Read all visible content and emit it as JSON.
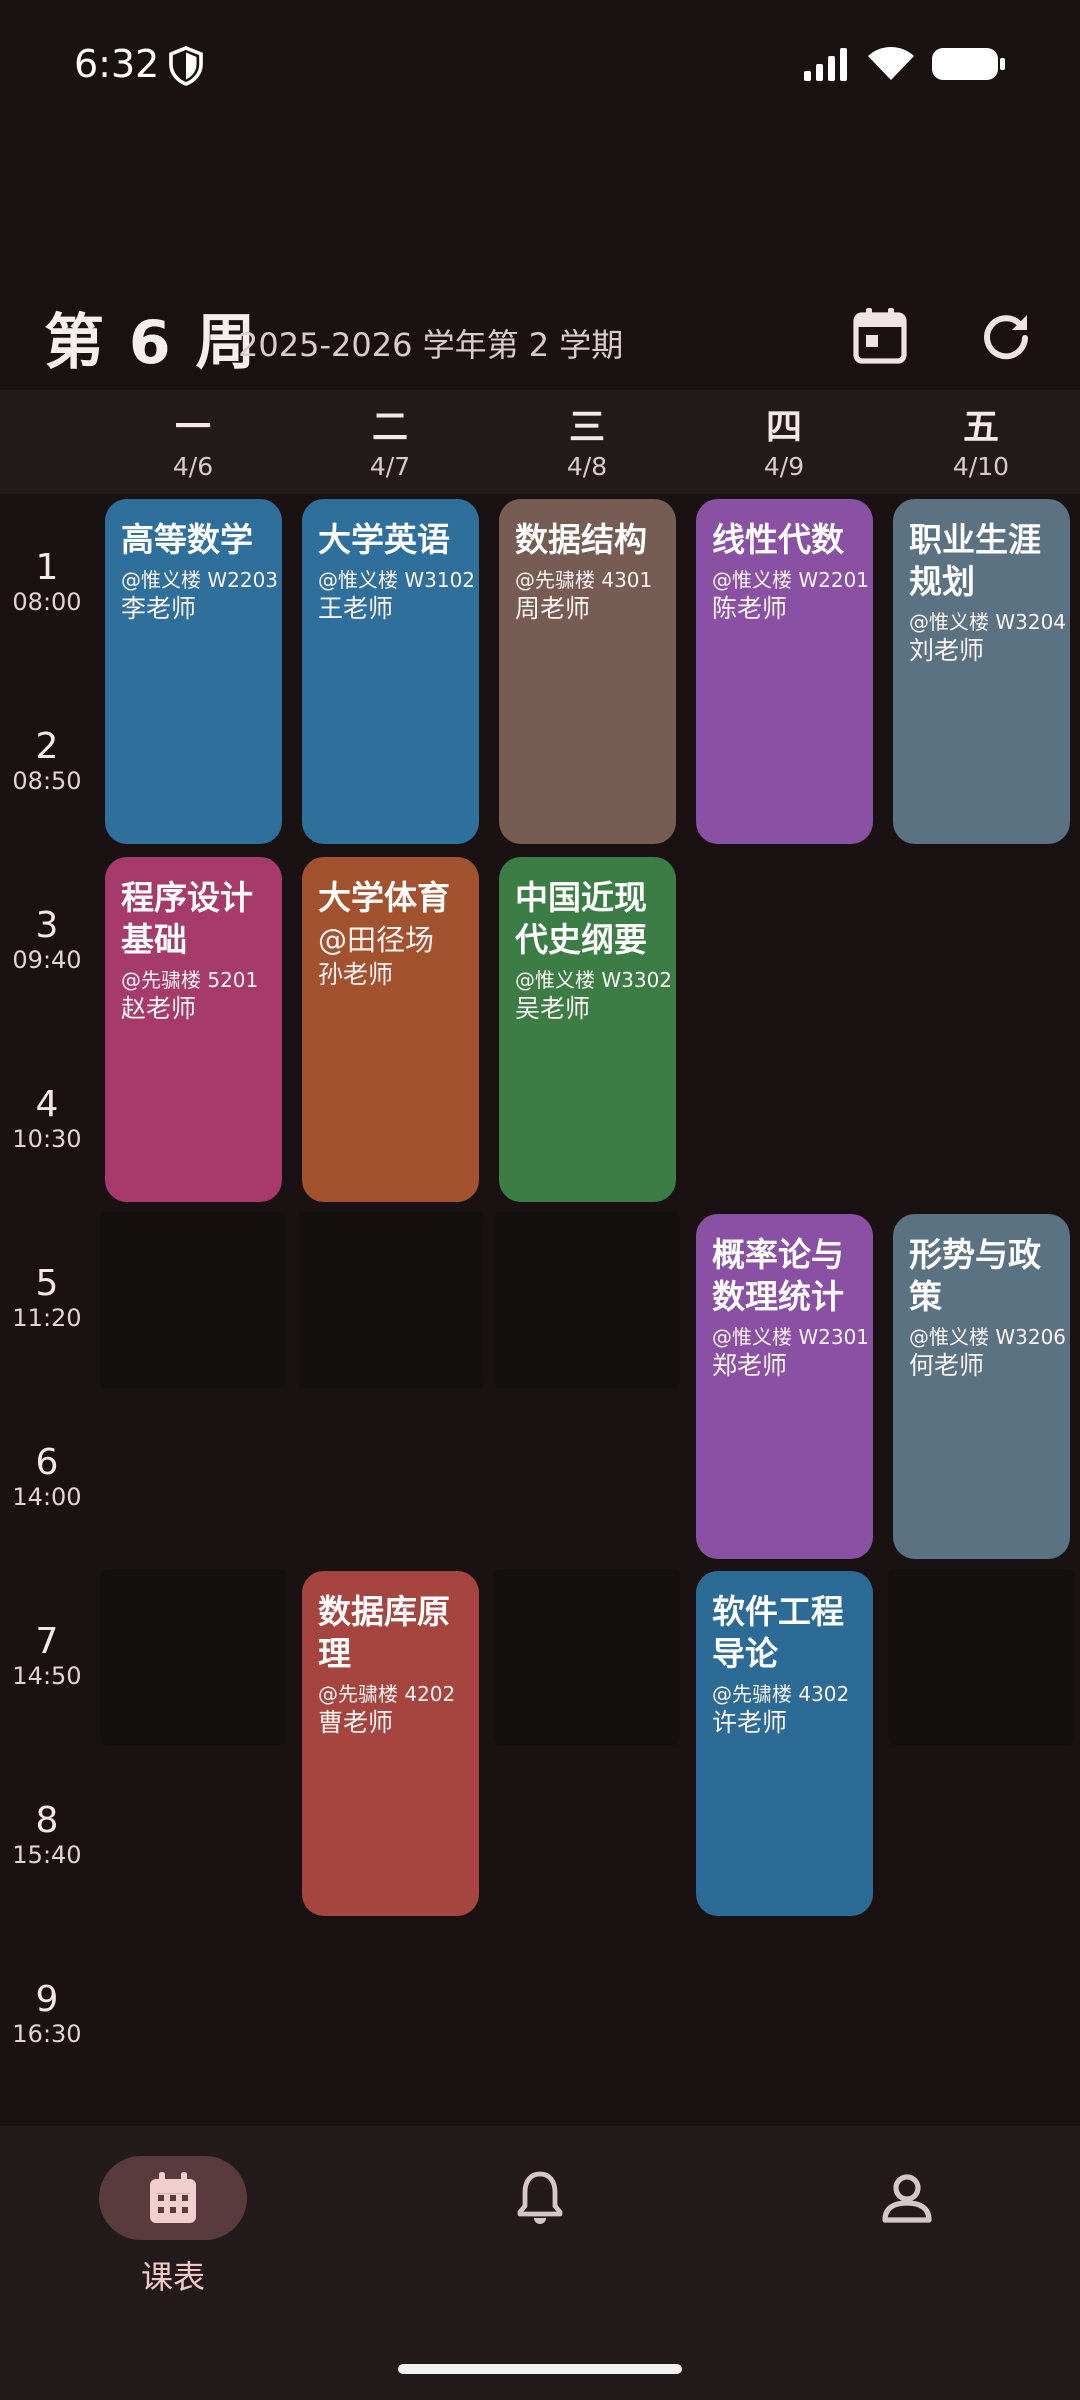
{
  "status_bar": {
    "time": "6:32"
  },
  "header": {
    "week": "第 6 周",
    "term": "2025-2026 学年第 2 学期"
  },
  "days": [
    {
      "name": "一",
      "date": "4/6"
    },
    {
      "name": "二",
      "date": "4/7"
    },
    {
      "name": "三",
      "date": "4/8"
    },
    {
      "name": "四",
      "date": "4/9"
    },
    {
      "name": "五",
      "date": "4/10"
    }
  ],
  "slots": [
    {
      "num": "1",
      "time": "08:00"
    },
    {
      "num": "2",
      "time": "08:50"
    },
    {
      "num": "3",
      "time": "09:40"
    },
    {
      "num": "4",
      "time": "10:30"
    },
    {
      "num": "5",
      "time": "11:20"
    },
    {
      "num": "6",
      "time": "14:00"
    },
    {
      "num": "7",
      "time": "14:50"
    },
    {
      "num": "8",
      "time": "15:40"
    },
    {
      "num": "9",
      "time": "16:30"
    }
  ],
  "courses": [
    {
      "name": "高等数学",
      "room": "@惟义楼 W2203",
      "teacher": "李老师",
      "color": "#2f6f9c"
    },
    {
      "name": "大学英语",
      "room": "@惟义楼 W3102",
      "teacher": "王老师",
      "color": "#2f6f9c"
    },
    {
      "name": "数据结构",
      "room": "@先骕楼 4301",
      "teacher": "周老师",
      "color": "#765c52"
    },
    {
      "name": "线性代数",
      "room": "@惟义楼 W2201",
      "teacher": "陈老师",
      "color": "#8a50a3"
    },
    {
      "name": "职业生涯规划",
      "room": "@惟义楼 W3204",
      "teacher": "刘老师",
      "color": "#5b7282"
    },
    {
      "name": "程序设计基础",
      "room": "@先骕楼 5201",
      "teacher": "赵老师",
      "color": "#a53a6b"
    },
    {
      "name": "大学体育",
      "room": "@田径场",
      "teacher": "孙老师",
      "color": "#a3522f"
    },
    {
      "name": "中国近现代史纲要",
      "room": "@惟义楼 W3302",
      "teacher": "吴老师",
      "color": "#3c7d45"
    },
    {
      "name": "概率论与数理统计",
      "room": "@惟义楼 W2301",
      "teacher": "郑老师",
      "color": "#8a50a3"
    },
    {
      "name": "形势与政策",
      "room": "@惟义楼 W3206",
      "teacher": "何老师",
      "color": "#5b7282"
    },
    {
      "name": "数据库原理",
      "room": "@先骕楼 4202",
      "teacher": "曹老师",
      "color": "#a64540"
    },
    {
      "name": "软件工程导论",
      "room": "@先骕楼 4302",
      "teacher": "许老师",
      "color": "#2d6b97"
    }
  ],
  "nav": {
    "schedule_label": "课表",
    "icons": [
      "calendar-icon",
      "bell-icon",
      "person-icon"
    ]
  }
}
